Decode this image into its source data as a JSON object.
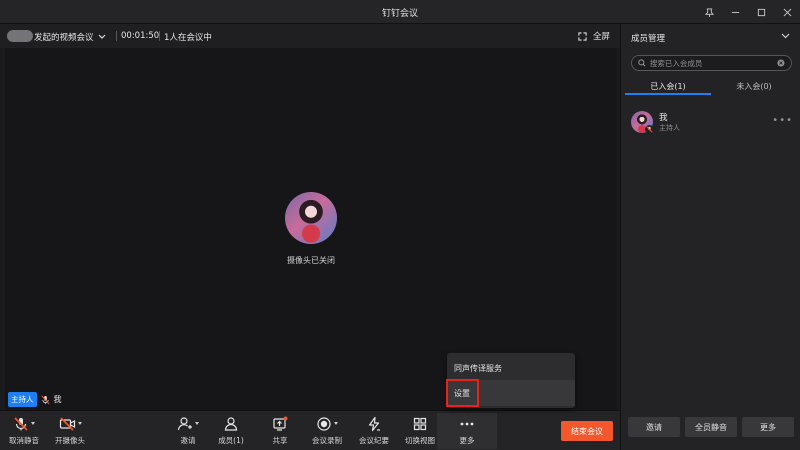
{
  "window": {
    "title": "钉钉会议"
  },
  "infobar": {
    "meeting_name": "发起的视频会议",
    "duration": "00:01:50",
    "participants": "1人在会议中",
    "fullscreen_label": "全屏"
  },
  "stage": {
    "camera_status": "摄像头已关闭",
    "host_badge": "主持人",
    "host_name": "我"
  },
  "toolbar": {
    "unmute": "取消静音",
    "camera_on": "开摄像头",
    "invite": "邀请",
    "members": "成员(1)",
    "share": "共享",
    "record": "会议录制",
    "minutes": "会议纪要",
    "switch_view": "切换视图",
    "more": "更多",
    "end_meeting": "结束会议"
  },
  "more_menu": {
    "items": [
      "同声传译服务",
      "设置"
    ]
  },
  "panel": {
    "title": "成员管理",
    "search_placeholder": "搜索已入会成员",
    "tabs": [
      "已入会(1)",
      "未入会(0)"
    ],
    "members": [
      {
        "name": "我",
        "role": "主持人"
      }
    ],
    "footer": [
      "邀请",
      "全员静音",
      "更多"
    ]
  },
  "colors": {
    "accent": "#1f7ef2",
    "end_button": "#f2582c",
    "highlight": "#e8231e"
  }
}
